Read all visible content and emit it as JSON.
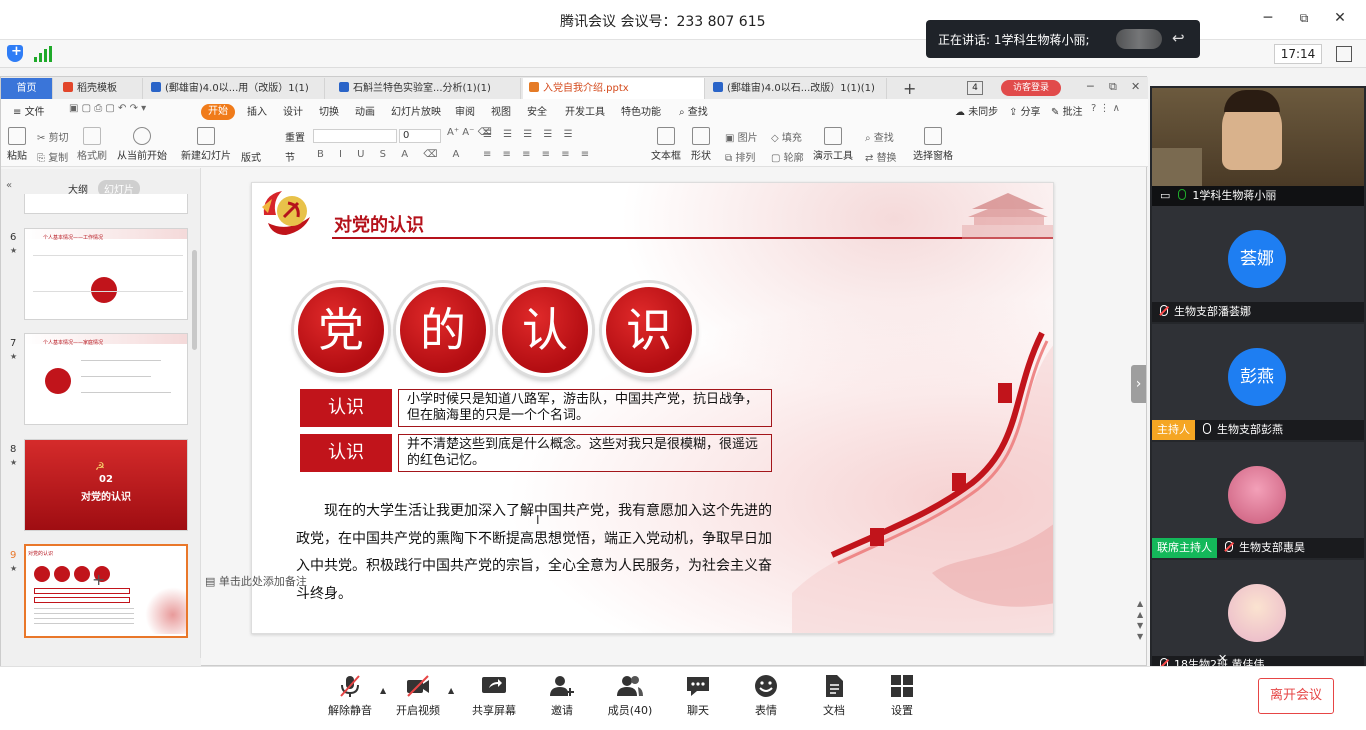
{
  "meeting": {
    "title": "腾讯会议 会议号：233 807 615",
    "clock": "17:14",
    "speaking_toast": "正在讲话: 1学科生物蒋小丽;"
  },
  "wps": {
    "tabs": [
      {
        "label": "首页"
      },
      {
        "label": "稻壳模板"
      },
      {
        "label": "(郵雄宙)4.0以...用（改版）1(1)"
      },
      {
        "label": "石斛兰特色实验室...分析(1)(1)"
      },
      {
        "label": "入党自我介绍.pptx"
      },
      {
        "label": "(郵雄宙)4.0以石...改版）1(1)(1)"
      }
    ],
    "tab_count": "4",
    "visitor_label": "访客登录",
    "menu": [
      "文件",
      "开始",
      "插入",
      "设计",
      "切换",
      "动画",
      "幻灯片放映",
      "审阅",
      "视图",
      "安全",
      "开发工具",
      "特色功能",
      "查找"
    ],
    "menu_right": [
      "未同步",
      "分享",
      "批注"
    ],
    "ribbon": {
      "paste": "粘贴",
      "cut": "剪切",
      "copy": "复制",
      "format_painter": "格式刷",
      "play_from_current": "从当前开始",
      "new_slide": "新建幻灯片",
      "layout": "版式",
      "section": "节",
      "reset": "重置",
      "font_size": "0",
      "textbox": "文本框",
      "shape": "形状",
      "arrange": "排列",
      "picture": "图片",
      "fill": "填充",
      "outline": "轮廓",
      "presentation_tools": "演示工具",
      "find": "查找",
      "replace": "替换",
      "select_pane": "选择窗格"
    },
    "panel_tabs": [
      "大纲",
      "幻灯片"
    ],
    "slides": [
      {
        "num": "6",
        "title": "个人基本情况——工作情况"
      },
      {
        "num": "7",
        "title": "个人基本情况——家庭情况"
      },
      {
        "num": "8",
        "title": "对党的认识",
        "badge": "02"
      },
      {
        "num": "9",
        "title": "对党的认识"
      }
    ],
    "notes_placeholder": "单击此处添加备注"
  },
  "slide": {
    "title": "对党的认识",
    "big_chars": [
      "党",
      "的",
      "认",
      "识"
    ],
    "rows": [
      {
        "label": "认识",
        "text": "小学时候只是知道八路军，游击队，中国共产党，抗日战争，但在脑海里的只是一个个名词。"
      },
      {
        "label": "认识",
        "text": "并不清楚这些到底是什么概念。这些对我只是很模糊，很遥远的红色记忆。"
      }
    ],
    "paragraph": "现在的大学生活让我更加深入了解中国共产党，我有意愿加入这个先进的政党，在中国共产党的熏陶下不断提高思想觉悟，端正入党动机，争取早日加入中共党。积极践行中国共产党的宗旨，全心全意为人民服务，为社会主义奋斗终身。"
  },
  "participants": [
    {
      "name": "1学科生物蒋小丽",
      "video": true
    },
    {
      "name": "生物支部潘荟娜",
      "avatar": "荟娜",
      "muted": true
    },
    {
      "name": "生物支部彭燕",
      "avatar": "彭燕",
      "role": "主持人",
      "role_color": "#f5a623"
    },
    {
      "name": "生物支部惠昊",
      "role": "联席主持人",
      "role_color": "#14b85a",
      "muted": true
    },
    {
      "name": "18生物2班 黄佳伟",
      "muted": true
    }
  ],
  "toolbar": {
    "items": [
      "解除静音",
      "开启视频",
      "共享屏幕",
      "邀请",
      "成员(40)",
      "聊天",
      "表情",
      "文档",
      "设置"
    ],
    "leave": "离开会议"
  },
  "colors": {
    "accent": "#f07b1a",
    "party_red": "#c1141b",
    "blue": "#1e7ef2"
  }
}
